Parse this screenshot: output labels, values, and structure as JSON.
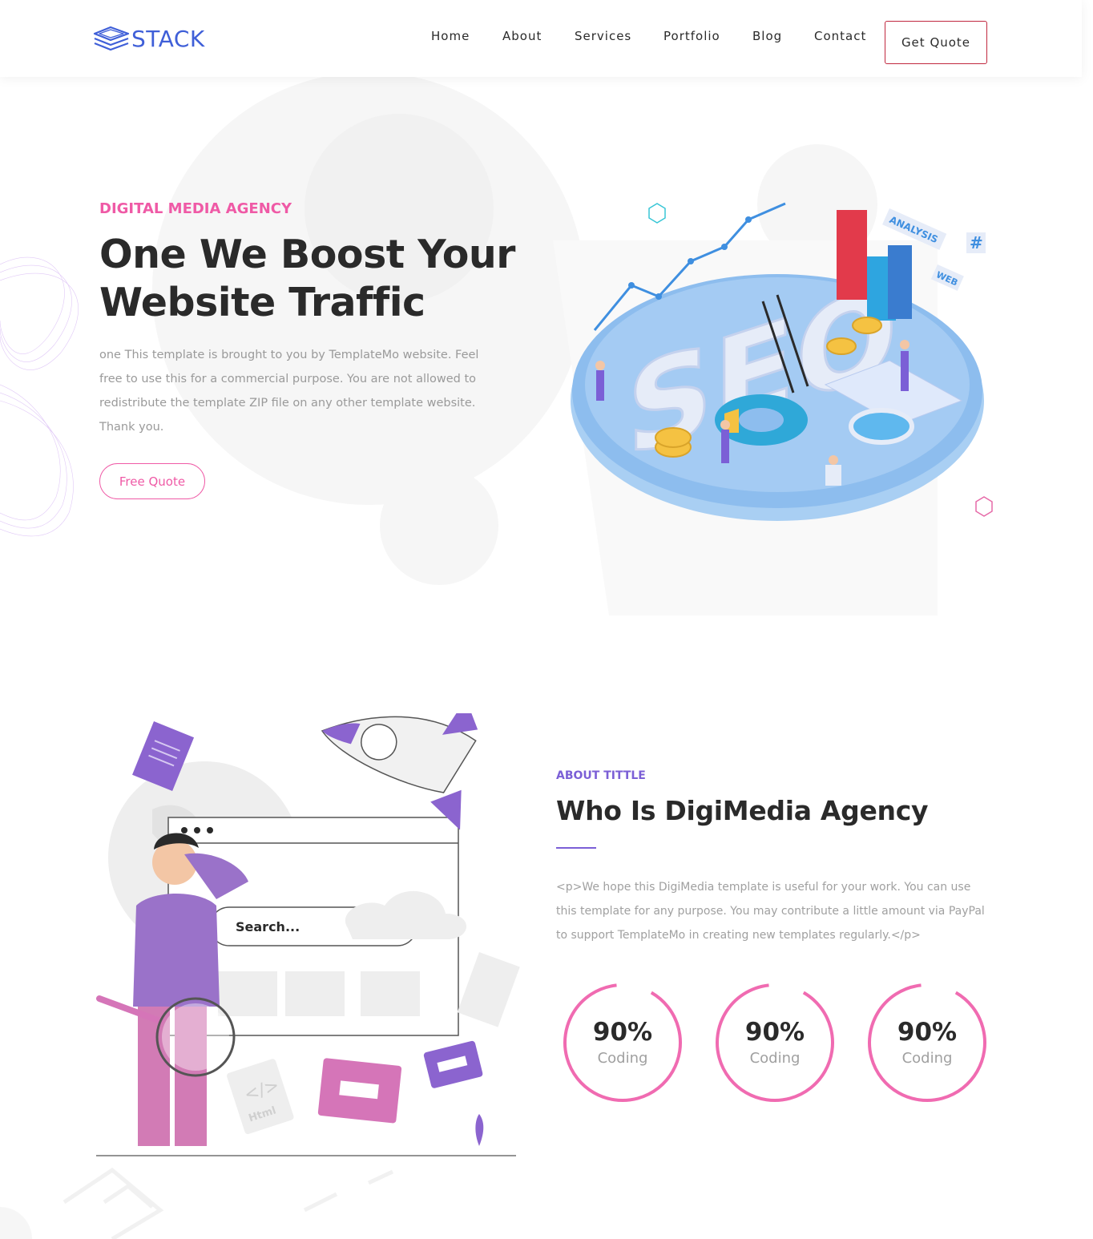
{
  "header": {
    "logo_text": "STACK",
    "nav": [
      {
        "label": "Home"
      },
      {
        "label": "About"
      },
      {
        "label": "Services"
      },
      {
        "label": "Portfolio"
      },
      {
        "label": "Blog"
      },
      {
        "label": "Contact"
      }
    ],
    "cta_label": "Get Quote"
  },
  "hero": {
    "kicker": "DIGITAL MEDIA AGENCY",
    "title_line1": "One We Boost Your",
    "title_line2": "Website Traffic",
    "text": "one This template is brought to you by TemplateMo website. Feel free to use this for a commercial purpose. You are not allowed to redistribute the template ZIP file on any other template website. Thank you.",
    "button_label": "Free Quote",
    "illustration": {
      "icon": "seo-isometric-illustration",
      "labels": [
        "SEO",
        "ANALYSIS",
        "WEB",
        "#"
      ]
    }
  },
  "about": {
    "kicker": "ABOUT TITTLE",
    "title": "Who Is DigiMedia Agency",
    "text": "<p>We hope this DigiMedia template is useful for your work. You can use this template for any purpose. You may contribute a little amount via PayPal to support TemplateMo in creating new templates regularly.</p>",
    "illustration": {
      "icon": "search-man-rocket-illustration",
      "labels": [
        "Search...",
        "Html"
      ]
    },
    "stats": [
      {
        "value": "90%",
        "label": "Coding",
        "progress": 0.9
      },
      {
        "value": "90%",
        "label": "Coding",
        "progress": 0.9
      },
      {
        "value": "90%",
        "label": "Coding",
        "progress": 0.9
      }
    ]
  },
  "colors": {
    "brand_blue": "#3f5fd8",
    "accent_pink": "#ef5aa6",
    "accent_purple": "#7b5fd6",
    "cta_border": "#c0283f",
    "text_dark": "#2a2a2a",
    "text_muted": "#9a9a9a"
  }
}
